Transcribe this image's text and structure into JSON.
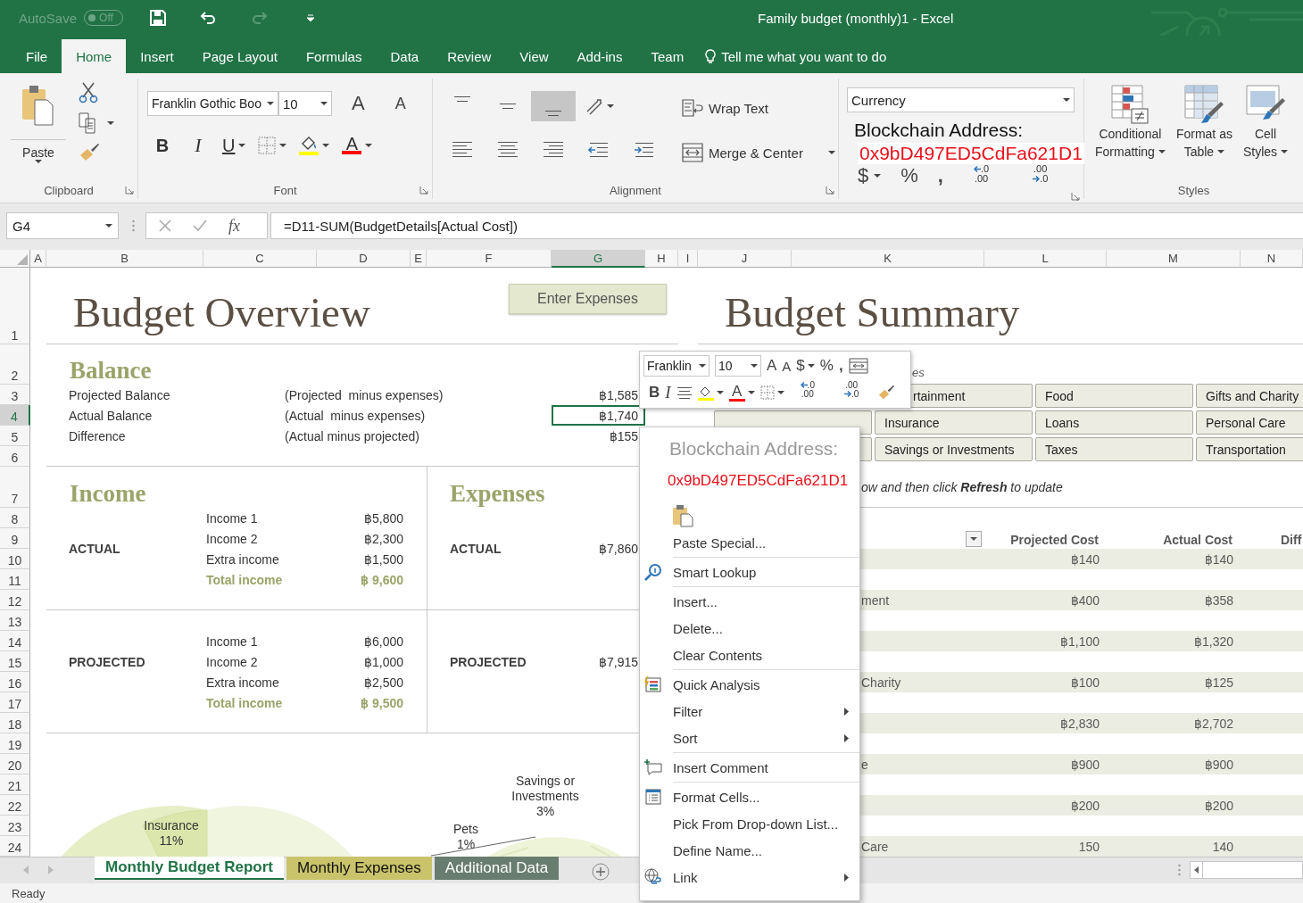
{
  "title_bar": {
    "autosave_label": "AutoSave",
    "autosave_toggle": {
      "label": "Off",
      "on": false
    },
    "title": "Family budget (monthly)1  -  Excel"
  },
  "menu_tabs": [
    {
      "label": "File",
      "selected": false
    },
    {
      "label": "Home",
      "selected": true
    },
    {
      "label": "Insert",
      "selected": false
    },
    {
      "label": "Page Layout",
      "selected": false
    },
    {
      "label": "Formulas",
      "selected": false
    },
    {
      "label": "Data",
      "selected": false
    },
    {
      "label": "Review",
      "selected": false
    },
    {
      "label": "View",
      "selected": false
    },
    {
      "label": "Add-ins",
      "selected": false
    },
    {
      "label": "Team",
      "selected": false
    }
  ],
  "tell_me": {
    "placeholder": "Tell me what you want to do"
  },
  "ribbon": {
    "clipboard": {
      "paste_label": "Paste",
      "group_label": "Clipboard"
    },
    "font": {
      "font_name": "Franklin Gothic Boo",
      "font_size": "10",
      "grow": "A",
      "shrink": "A",
      "bold": "B",
      "italic": "I",
      "underline": "U",
      "font_color": "A",
      "group_label": "Font"
    },
    "alignment": {
      "vertical": [
        {
          "selected": false
        },
        {
          "selected": false
        },
        {
          "selected": true
        }
      ],
      "wrap_text": "Wrap Text",
      "merge_center": "Merge & Center",
      "group_label": "Alignment"
    },
    "number": {
      "format": "Currency",
      "address_label": "Blockchain Address:",
      "address": "0x9bD497ED5CdFa621D1",
      "currency": "$",
      "percent": "%",
      "comma": ",",
      "increase_decimal": [
        ".0",
        ".00"
      ],
      "decrease_decimal": [
        ".00",
        ".0"
      ]
    },
    "styles": {
      "buttons": [
        {
          "lines": [
            "Conditional",
            "Formatting"
          ]
        },
        {
          "lines": [
            "Format as",
            "Table"
          ]
        },
        {
          "lines": [
            "Cell",
            "Styles"
          ]
        }
      ],
      "group_label": "Styles"
    }
  },
  "formula_bar": {
    "name_box": "G4",
    "fx": "fx",
    "formula": "=D11-SUM(BudgetDetails[Actual Cost])"
  },
  "columns": [
    {
      "label": "A",
      "selected": false
    },
    {
      "label": "B",
      "selected": false
    },
    {
      "label": "C",
      "selected": false
    },
    {
      "label": "D",
      "selected": false
    },
    {
      "label": "E",
      "selected": false
    },
    {
      "label": "F",
      "selected": false
    },
    {
      "label": "G",
      "selected": true
    },
    {
      "label": "H",
      "selected": false
    },
    {
      "label": "I",
      "selected": false
    },
    {
      "label": "J",
      "selected": false
    },
    {
      "label": "K",
      "selected": false
    },
    {
      "label": "L",
      "selected": false
    },
    {
      "label": "M",
      "selected": false
    },
    {
      "label": "N",
      "selected": false
    }
  ],
  "rows": [
    {
      "label": "1",
      "selected": false
    },
    {
      "label": "2",
      "selected": false
    },
    {
      "label": "3",
      "selected": false
    },
    {
      "label": "4",
      "selected": true
    },
    {
      "label": "5",
      "selected": false
    },
    {
      "label": "6",
      "selected": false
    },
    {
      "label": "7",
      "selected": false
    },
    {
      "label": "8",
      "selected": false
    },
    {
      "label": "9",
      "selected": false
    },
    {
      "label": "10",
      "selected": false
    },
    {
      "label": "11",
      "selected": false
    },
    {
      "label": "12",
      "selected": false
    },
    {
      "label": "13",
      "selected": false
    },
    {
      "label": "14",
      "selected": false
    },
    {
      "label": "15",
      "selected": false
    },
    {
      "label": "16",
      "selected": false
    },
    {
      "label": "17",
      "selected": false
    },
    {
      "label": "18",
      "selected": false
    },
    {
      "label": "19",
      "selected": false
    },
    {
      "label": "20",
      "selected": false
    },
    {
      "label": "21",
      "selected": false
    },
    {
      "label": "22",
      "selected": false
    },
    {
      "label": "23",
      "selected": false
    },
    {
      "label": "24",
      "selected": false
    }
  ],
  "overview": {
    "title": "Budget Overview",
    "button": "Enter Expenses",
    "balance": {
      "heading": "Balance",
      "rows": [
        {
          "label": "Projected Balance",
          "note": "(Projected  minus expenses)",
          "value": "฿1,585",
          "selected": false
        },
        {
          "label": "Actual Balance",
          "note": "(Actual  minus expenses)",
          "value": "฿1,740",
          "selected": true
        },
        {
          "label": "Difference",
          "note": "(Actual minus projected)",
          "value": "฿155",
          "selected": false
        }
      ]
    },
    "income": {
      "heading": "Income",
      "groups": [
        {
          "label": "ACTUAL",
          "items": [
            {
              "label": "Income 1",
              "value": "฿5,800"
            },
            {
              "label": "Income 2",
              "value": "฿2,300"
            },
            {
              "label": "Extra income",
              "value": "฿1,500"
            }
          ],
          "total": {
            "label": "Total income",
            "value": "฿ 9,600"
          }
        },
        {
          "label": "PROJECTED",
          "items": [
            {
              "label": "Income 1",
              "value": "฿6,000"
            },
            {
              "label": "Income 2",
              "value": "฿1,000"
            },
            {
              "label": "Extra income",
              "value": "฿2,500"
            }
          ],
          "total": {
            "label": "Total income",
            "value": "฿ 9,500"
          }
        }
      ]
    },
    "expenses": {
      "heading": "Expenses",
      "groups": [
        {
          "label": "ACTUAL",
          "value": "฿7,860"
        },
        {
          "label": "PROJECTED",
          "value": "฿7,915"
        }
      ]
    },
    "chart_labels": [
      {
        "lines": [
          "Insurance",
          "11%"
        ]
      },
      {
        "lines": [
          "Pets",
          "1%"
        ]
      },
      {
        "lines": [
          "Savings or",
          "Investments",
          "3%"
        ]
      }
    ]
  },
  "summary": {
    "title": "Budget Summary",
    "hint": "es",
    "categories": [
      {
        "kind": "hidden"
      },
      {
        "kind": "partial",
        "label": "rtainment"
      },
      {
        "kind": "full",
        "label": "Food"
      },
      {
        "kind": "full",
        "label": "Gifts and Charity"
      },
      {
        "kind": "blank"
      },
      {
        "kind": "full",
        "label": "Insurance"
      },
      {
        "kind": "full",
        "label": "Loans"
      },
      {
        "kind": "full",
        "label": "Personal Care"
      },
      {
        "kind": "blank"
      },
      {
        "kind": "full",
        "label": "Savings or Investments"
      },
      {
        "kind": "full",
        "label": "Taxes"
      },
      {
        "kind": "full",
        "label": "Transportation"
      }
    ],
    "instruction": "ow and then click **Refresh** to update",
    "table": {
      "columns": [
        "Projected Cost",
        "Actual Cost",
        "Diff"
      ],
      "rows": [
        {
          "projected": "฿140",
          "actual": "฿140"
        },
        {
          "category": "ment",
          "projected": "฿400",
          "actual": "฿358"
        },
        {
          "projected": "฿1,100",
          "actual": "฿1,320"
        },
        {
          "category": "Charity",
          "projected": "฿100",
          "actual": "฿125"
        },
        {
          "projected": "฿2,830",
          "actual": "฿2,702"
        },
        {
          "category": "e",
          "projected": "฿900",
          "actual": "฿900"
        },
        {
          "projected": "฿200",
          "actual": "฿200"
        },
        {
          "category": "Care",
          "projected": "150",
          "actual": "140"
        }
      ]
    }
  },
  "mini_toolbar": {
    "font_name": "Franklin",
    "font_size": "10",
    "grow": "A",
    "shrink": "A",
    "currency": "$",
    "percent": "%",
    "comma": ",",
    "bold": "B",
    "italic": "I",
    "font_color": "A",
    "increase_decimal": [
      ".0",
      ".00"
    ],
    "decrease_decimal": [
      ".00",
      ".0"
    ]
  },
  "context_menu": {
    "address_label": "Blockchain Address:",
    "address": "0x9bD497ED5CdFa621D1",
    "items": [
      {
        "label": "Paste Special...",
        "kind": "plain",
        "submenu": false,
        "separator_after": true
      },
      {
        "label": "Smart Lookup",
        "kind": "lookup",
        "submenu": false,
        "separator_after": true
      },
      {
        "label": "Insert...",
        "kind": "plain",
        "submenu": false,
        "separator_after": false
      },
      {
        "label": "Delete...",
        "kind": "plain",
        "submenu": false,
        "separator_after": false
      },
      {
        "label": "Clear Contents",
        "kind": "plain",
        "submenu": false,
        "separator_after": true
      },
      {
        "label": "Quick Analysis",
        "kind": "analysis",
        "submenu": false,
        "separator_after": false
      },
      {
        "label": "Filter",
        "kind": "plain",
        "submenu": true,
        "separator_after": false
      },
      {
        "label": "Sort",
        "kind": "plain",
        "submenu": true,
        "separator_after": true
      },
      {
        "label": "Insert Comment",
        "kind": "comment",
        "submenu": false,
        "separator_after": true
      },
      {
        "label": "Format Cells...",
        "kind": "format",
        "submenu": false,
        "separator_after": false
      },
      {
        "label": "Pick From Drop-down List...",
        "kind": "plain",
        "submenu": false,
        "separator_after": false
      },
      {
        "label": "Define Name...",
        "kind": "plain",
        "submenu": false,
        "separator_after": false
      },
      {
        "label": "Link",
        "kind": "link",
        "submenu": true,
        "separator_after": false
      }
    ]
  },
  "sheet_tabs": [
    {
      "label": "Monthly Budget Report",
      "selected": true,
      "color": "#217346"
    },
    {
      "label": "Monthly Expenses",
      "selected": false,
      "color": "#c9c36b"
    },
    {
      "label": "Additional Data",
      "selected": false,
      "color": "#687d70"
    }
  ],
  "status_bar": {
    "text": "Ready"
  }
}
